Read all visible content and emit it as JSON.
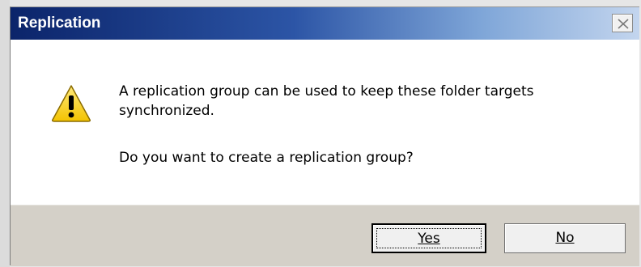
{
  "window": {
    "title": "Replication",
    "close_icon": "close-icon"
  },
  "message": {
    "icon": "warning-icon",
    "line1": "A replication group can be used to keep these folder targets synchronized.",
    "line2": "Do you want to create a replication group?"
  },
  "buttons": {
    "yes_label": "Yes",
    "no_label": "No"
  },
  "colors": {
    "titlebar_start": "#0b246a",
    "titlebar_end": "#c3d5ee",
    "footer": "#d4d0c8"
  }
}
